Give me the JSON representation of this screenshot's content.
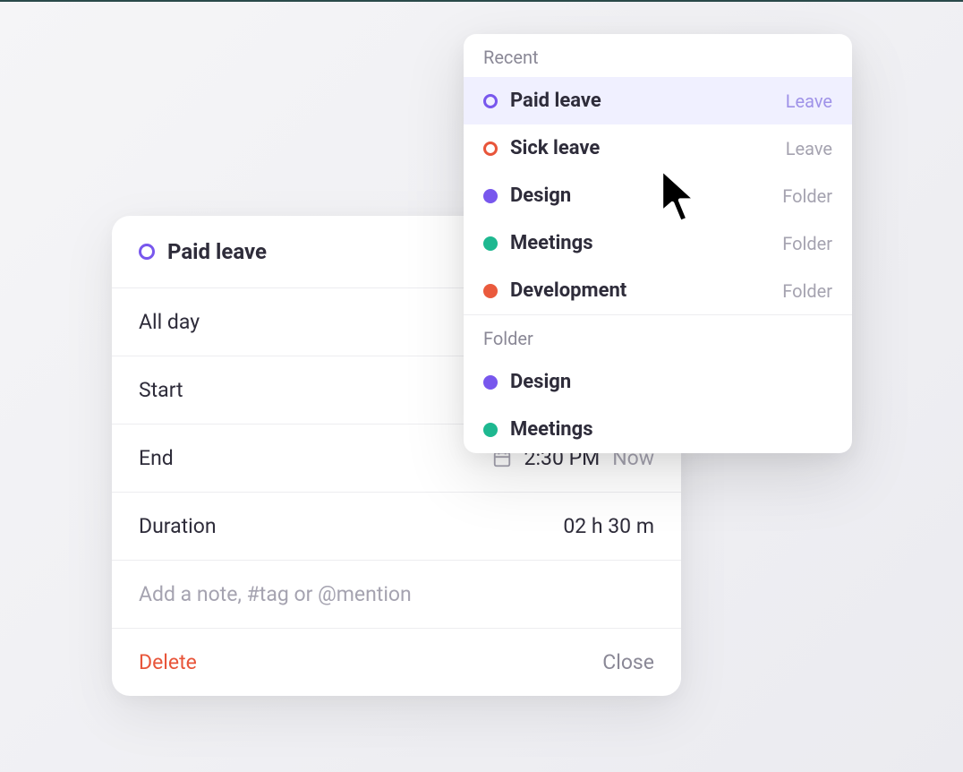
{
  "colors": {
    "purple": "#7857ED",
    "red": "#e8553a",
    "teal": "#1eb890",
    "orange": "#ea5a3d",
    "muted": "#a5a3b0",
    "purpleLight": "#9f92e8"
  },
  "entry": {
    "title": "Paid leave",
    "allDayLabel": "All day",
    "startLabel": "Start",
    "endLabel": "End",
    "endValue": "2:30 PM",
    "endNow": "Now",
    "durationLabel": "Duration",
    "durationValue": "02 h  30 m",
    "notePlaceholder": "Add a note, #tag or @mention",
    "deleteLabel": "Delete",
    "closeLabel": "Close"
  },
  "dropdown": {
    "recentLabel": "Recent",
    "folderLabel": "Folder",
    "recent": [
      {
        "label": "Paid leave",
        "type": "Leave",
        "color": "#7857ED",
        "outline": true,
        "selected": true,
        "typeColor": "#9f92e8"
      },
      {
        "label": "Sick leave",
        "type": "Leave",
        "color": "#e8553a",
        "outline": true,
        "selected": false,
        "typeColor": "#a5a3b0"
      },
      {
        "label": "Design",
        "type": "Folder",
        "color": "#7857ED",
        "outline": false,
        "selected": false,
        "typeColor": "#a5a3b0"
      },
      {
        "label": "Meetings",
        "type": "Folder",
        "color": "#1eb890",
        "outline": false,
        "selected": false,
        "typeColor": "#a5a3b0"
      },
      {
        "label": "Development",
        "type": "Folder",
        "color": "#ea5a3d",
        "outline": false,
        "selected": false,
        "typeColor": "#a5a3b0"
      }
    ],
    "folders": [
      {
        "label": "Design",
        "color": "#7857ED"
      },
      {
        "label": "Meetings",
        "color": "#1eb890"
      }
    ]
  }
}
